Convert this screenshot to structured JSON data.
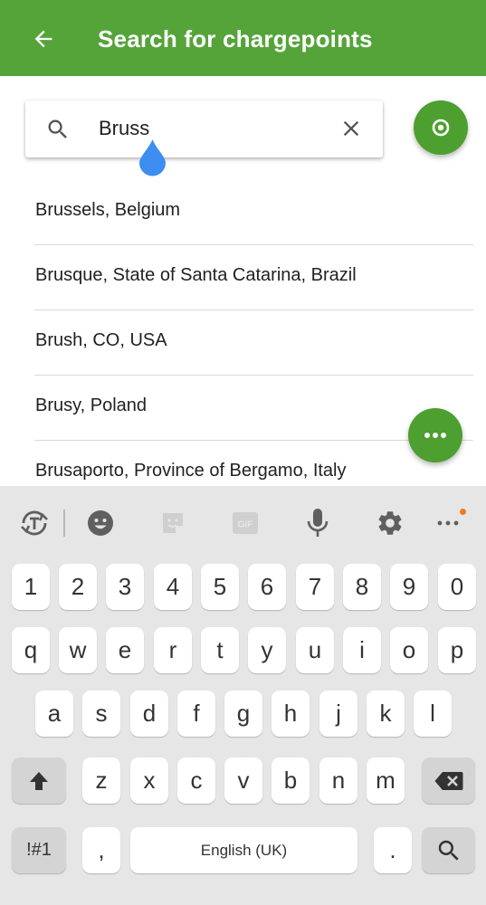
{
  "appbar": {
    "title": "Search for chargepoints",
    "back_icon": "arrow-left-icon",
    "color": "#55a43a"
  },
  "search": {
    "value": "Bruss",
    "search_icon": "search-icon",
    "clear_icon": "close-icon",
    "cursor_color": "#3d8ef0"
  },
  "locate_button": {
    "icon": "target-location-icon",
    "color": "#4d9f2f"
  },
  "suggestions": [
    "Brussels, Belgium",
    "Brusque, State of Santa Catarina, Brazil",
    "Brush, CO, USA",
    "Brusy, Poland",
    "Brusaporto, Province of Bergamo, Italy"
  ],
  "more_button": {
    "icon": "more-horizontal-icon",
    "color": "#4d9f2f"
  },
  "keyboard": {
    "toolbar": [
      "translate-icon",
      "emoji-icon",
      "sticker-icon",
      "gif-icon",
      "microphone-icon",
      "settings-icon",
      "more-icon"
    ],
    "gif_label": "GIF",
    "rows": {
      "numbers": [
        "1",
        "2",
        "3",
        "4",
        "5",
        "6",
        "7",
        "8",
        "9",
        "0"
      ],
      "row1": [
        "q",
        "w",
        "e",
        "r",
        "t",
        "y",
        "u",
        "i",
        "o",
        "p"
      ],
      "row2": [
        "a",
        "s",
        "d",
        "f",
        "g",
        "h",
        "j",
        "k",
        "l"
      ],
      "row3": [
        "z",
        "x",
        "c",
        "v",
        "b",
        "n",
        "m"
      ]
    },
    "symbols_label": "!#1",
    "comma_label": ",",
    "space_label": "English (UK)",
    "period_label": ".",
    "notification_color": "#f07a22"
  }
}
